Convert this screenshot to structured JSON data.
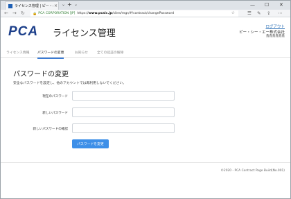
{
  "browser": {
    "tab_title": "ライセンス管理 | ピー・シー・",
    "tab_close": "×",
    "new_tab": "+",
    "tab_menu": "⌄",
    "address": {
      "cert": "PCA CORPORATION [JP]",
      "url_prefix": "https://",
      "url_host": "www.pcaic.jp",
      "url_path": "/sites/mgr/#/contract/changePassword"
    },
    "window_controls": {
      "minimize": "—",
      "maximize": "☐",
      "close": "✕"
    }
  },
  "header": {
    "logo": "PCA",
    "title": "ライセンス管理",
    "logout": "ログアウト",
    "company": "ピー・シー・エー株式会社",
    "user": "鑫鑫鑫鑫鑫鑫"
  },
  "nav": {
    "items": [
      {
        "label": "ライセンス情報"
      },
      {
        "label": "パスワードの変更"
      },
      {
        "label": "お知らせ"
      },
      {
        "label": "全ての認証の解除"
      }
    ],
    "active_index": 1
  },
  "form": {
    "title": "パスワードの変更",
    "description": "安全なパスワードを設定し、他のアカウントでは再利用しないでください。",
    "fields": [
      {
        "label": "現在のパスワード",
        "value": ""
      },
      {
        "label": "新しいパスワード",
        "value": ""
      },
      {
        "label": "新しいパスワードの確認",
        "value": ""
      }
    ],
    "submit": "パスワードを変更"
  },
  "footer": {
    "copyright": "©2020 - PCA Contract Page Build(No.001)"
  },
  "colors": {
    "accent": "#3d8fe8",
    "logo": "#1c3f8a",
    "link": "#2a6fb6"
  },
  "icons": [
    "back-icon",
    "forward-icon",
    "refresh-icon",
    "lock-icon",
    "star-icon",
    "favorites-icon",
    "share-icon",
    "menu-icon"
  ]
}
